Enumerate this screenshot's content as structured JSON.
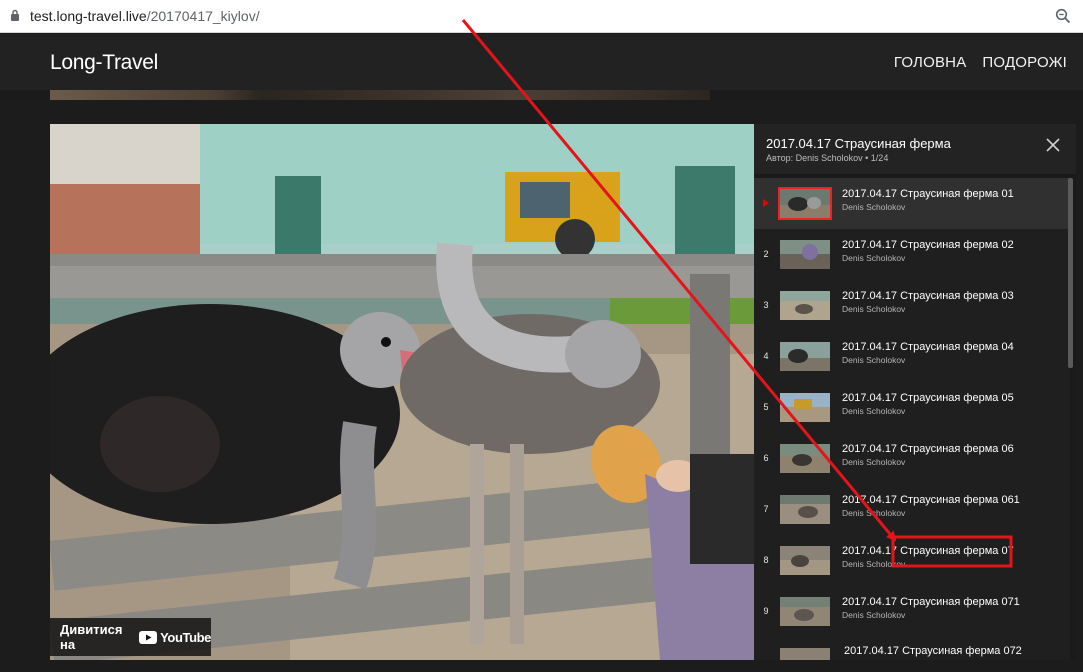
{
  "browser": {
    "url_host": "test.long-travel.live",
    "url_path": "/20170417_kiylov/"
  },
  "site": {
    "logo": "Long-Travel",
    "nav": [
      "ГОЛОВНА",
      "ПОДОРОЖІ"
    ]
  },
  "video": {
    "watch_on": "Дивитися на",
    "platform": "YouTube"
  },
  "playlist": {
    "title": "2017.04.17 Страусиная ферма",
    "subtitle": "Автор: Denis Scholokov • 1/24",
    "items": [
      {
        "num": "",
        "title": "2017.04.17 Страусиная ферма 01",
        "author": "Denis Scholokov",
        "active": true
      },
      {
        "num": "2",
        "title": "2017.04.17 Страусиная ферма 02",
        "author": "Denis Scholokov"
      },
      {
        "num": "3",
        "title": "2017.04.17 Страусиная ферма 03",
        "author": "Denis Scholokov"
      },
      {
        "num": "4",
        "title": "2017.04.17 Страусиная ферма 04",
        "author": "Denis Scholokov"
      },
      {
        "num": "5",
        "title": "2017.04.17 Страусиная ферма 05",
        "author": "Denis Scholokov"
      },
      {
        "num": "6",
        "title": "2017.04.17 Страусиная ферма 06",
        "author": "Denis Scholokov"
      },
      {
        "num": "7",
        "title": "2017.04.17 Страусиная ферма 061",
        "author": "Denis Scholokov"
      },
      {
        "num": "8",
        "title": "2017.04.17 Страусиная ферма 07",
        "author": "Denis Scholokov"
      },
      {
        "num": "9",
        "title": "2017.04.17 Страусиная ферма 071",
        "author": "Denis Scholokov"
      },
      {
        "num": "",
        "title": "2017.04.17 Страусиная ферма 072",
        "author": ""
      }
    ]
  },
  "colors": {
    "accent_red": "#e4141b",
    "header_bg": "#222222",
    "panel_bg": "#1a1a1a"
  },
  "icons": {
    "lock": "lock-icon",
    "zoom": "zoom-icon",
    "close": "close-icon",
    "play": "play-icon"
  }
}
